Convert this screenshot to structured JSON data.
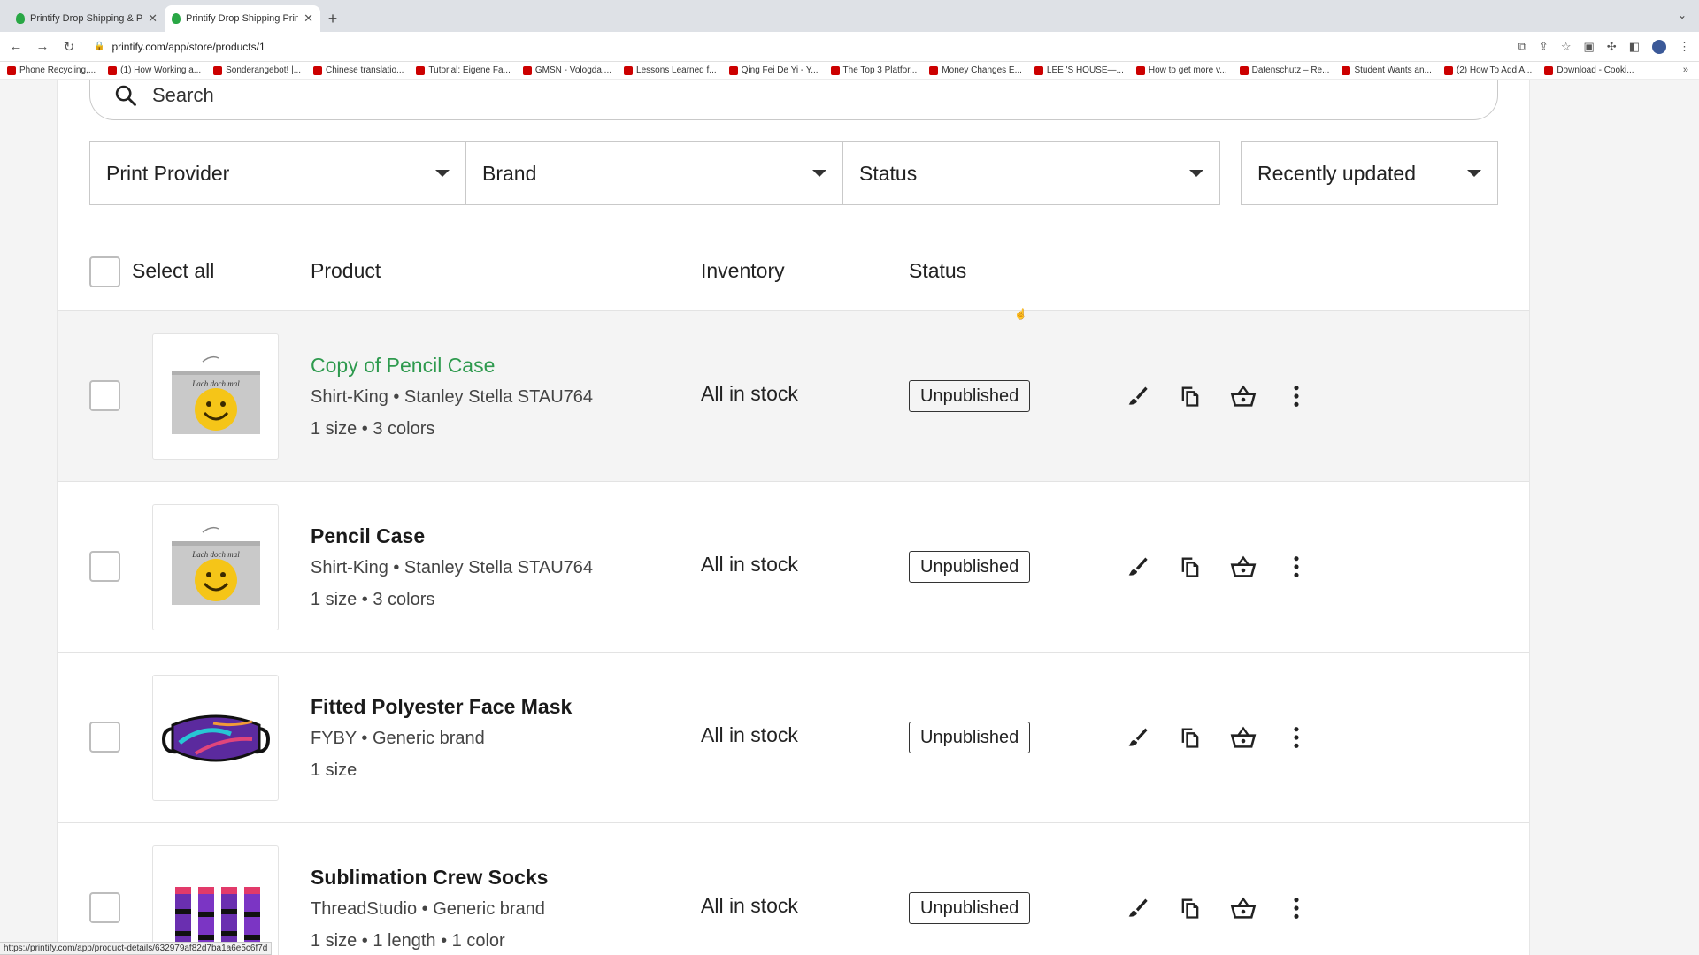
{
  "browser": {
    "tabs": [
      {
        "title": "Printify Drop Shipping & Printin"
      },
      {
        "title": "Printify Drop Shipping Print on"
      }
    ],
    "new_tab": "+",
    "url": "printify.com/app/store/products/1",
    "bookmarks": [
      "Phone Recycling,...",
      "(1) How Working a...",
      "Sonderangebot! |...",
      "Chinese translatio...",
      "Tutorial: Eigene Fa...",
      "GMSN - Vologda,...",
      "Lessons Learned f...",
      "Qing Fei De Yi - Y...",
      "The Top 3 Platfor...",
      "Money Changes E...",
      "LEE 'S HOUSE—...",
      "How to get more v...",
      "Datenschutz – Re...",
      "Student Wants an...",
      "(2) How To Add A...",
      "Download - Cooki..."
    ],
    "status_url": "https://printify.com/app/product-details/632979af82d7ba1a6e5c6f7d"
  },
  "search": {
    "placeholder": "Search"
  },
  "filters": {
    "print_provider": "Print Provider",
    "brand": "Brand",
    "status": "Status",
    "sort": "Recently updated"
  },
  "table": {
    "select_all": "Select all",
    "col_product": "Product",
    "col_inventory": "Inventory",
    "col_status": "Status"
  },
  "products": [
    {
      "name": "Copy of Pencil Case",
      "meta": "Shirt-King • Stanley Stella STAU764",
      "variants": "1 size • 3 colors",
      "inventory": "All in stock",
      "status": "Unpublished",
      "thumb_text": "Lach doch mal"
    },
    {
      "name": "Pencil Case",
      "meta": "Shirt-King • Stanley Stella STAU764",
      "variants": "1 size • 3 colors",
      "inventory": "All in stock",
      "status": "Unpublished",
      "thumb_text": "Lach doch mal"
    },
    {
      "name": "Fitted Polyester Face Mask",
      "meta": "FYBY • Generic brand",
      "variants": "1 size",
      "inventory": "All in stock",
      "status": "Unpublished"
    },
    {
      "name": "Sublimation Crew Socks",
      "meta": "ThreadStudio • Generic brand",
      "variants": "1 size • 1 length • 1 color",
      "inventory": "All in stock",
      "status": "Unpublished"
    }
  ],
  "colors": {
    "link_green": "#2e9a4e",
    "hover_row": "#f4f4f4"
  }
}
